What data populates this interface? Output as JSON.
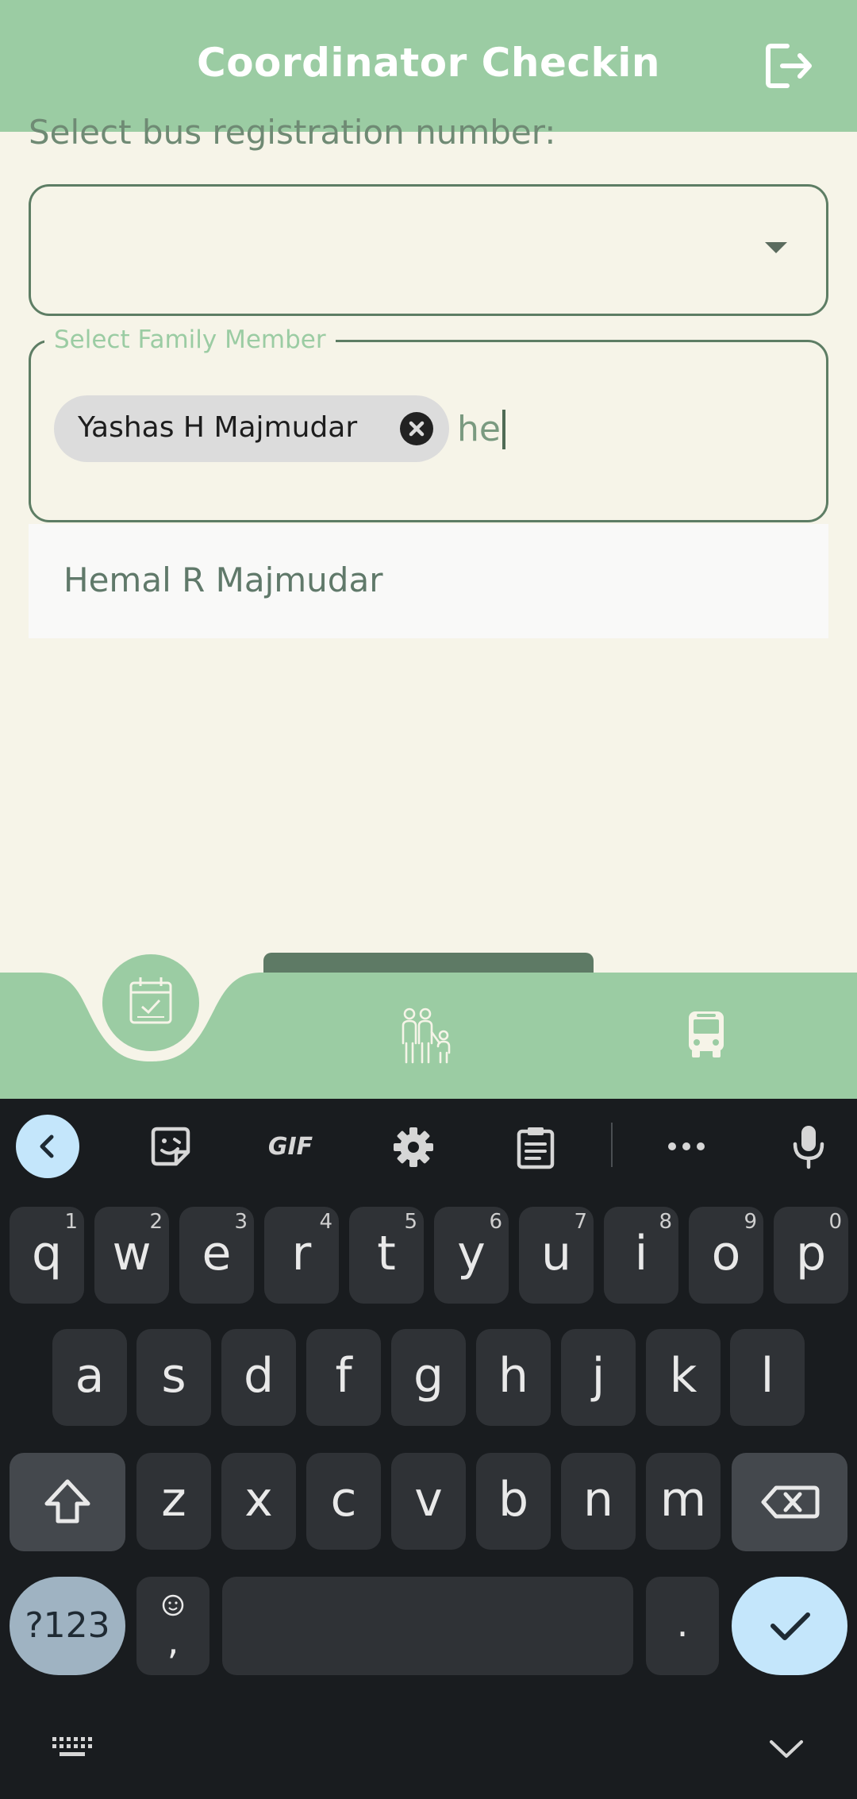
{
  "header": {
    "title": "Coordinator Checkin",
    "logout_icon": "logout-icon"
  },
  "form": {
    "bus_label": "Select bus registration number:",
    "bus_value": "",
    "family_label": "Select Family Member",
    "selected_chips": [
      "Yashas H Majmudar"
    ],
    "input_value": "he",
    "suggestions": [
      "Hemal R Majmudar"
    ]
  },
  "bottom_nav": {
    "items": [
      {
        "icon": "calendar-check-icon",
        "active": true
      },
      {
        "icon": "family-icon",
        "active": false
      },
      {
        "icon": "bus-icon",
        "active": false
      }
    ]
  },
  "keyboard": {
    "toolbar": [
      "back-icon",
      "sticker-icon",
      "gif-icon",
      "settings-icon",
      "clipboard-icon",
      "more-icon",
      "microphone-icon"
    ],
    "gif_label": "GIF",
    "row1": [
      "q",
      "w",
      "e",
      "r",
      "t",
      "y",
      "u",
      "i",
      "o",
      "p"
    ],
    "row1_hints": [
      "1",
      "2",
      "3",
      "4",
      "5",
      "6",
      "7",
      "8",
      "9",
      "0"
    ],
    "row2": [
      "a",
      "s",
      "d",
      "f",
      "g",
      "h",
      "j",
      "k",
      "l"
    ],
    "row3": [
      "z",
      "x",
      "c",
      "v",
      "b",
      "n",
      "m"
    ],
    "symbols_label": "?123",
    "comma_label": ",",
    "period_label": "."
  },
  "colors": {
    "header": "#9bcca3",
    "background": "#f6f4e8",
    "accent_dark": "#5e7a65",
    "keyboard_bg": "#191c1f",
    "key": "#2f3236"
  }
}
